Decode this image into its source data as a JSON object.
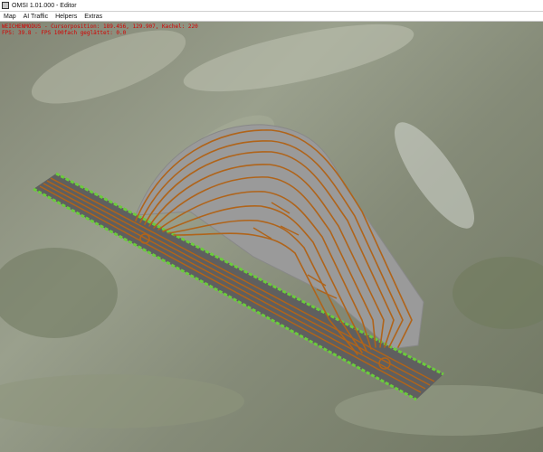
{
  "window": {
    "title": "OMSI 1.01.000 - Editor",
    "icon": "app-icon"
  },
  "menu": [
    {
      "label": "Map"
    },
    {
      "label": "AI Traffic"
    },
    {
      "label": "Helpers"
    },
    {
      "label": "Extras"
    }
  ],
  "overlay": {
    "line1": "WEICHENMODUS - Cursorposition: 189.456, 129.907, Kachel: 220",
    "line2": "FPS: 39.8 - FPS 100fach geglättet: 0.0"
  },
  "colors": {
    "overlay_text": "#d40000",
    "track_rails": "#b0641a",
    "road_asphalt": "#6a6a6a",
    "grass_edge": "#6bcc3c",
    "platform": "#9c9c9c"
  }
}
